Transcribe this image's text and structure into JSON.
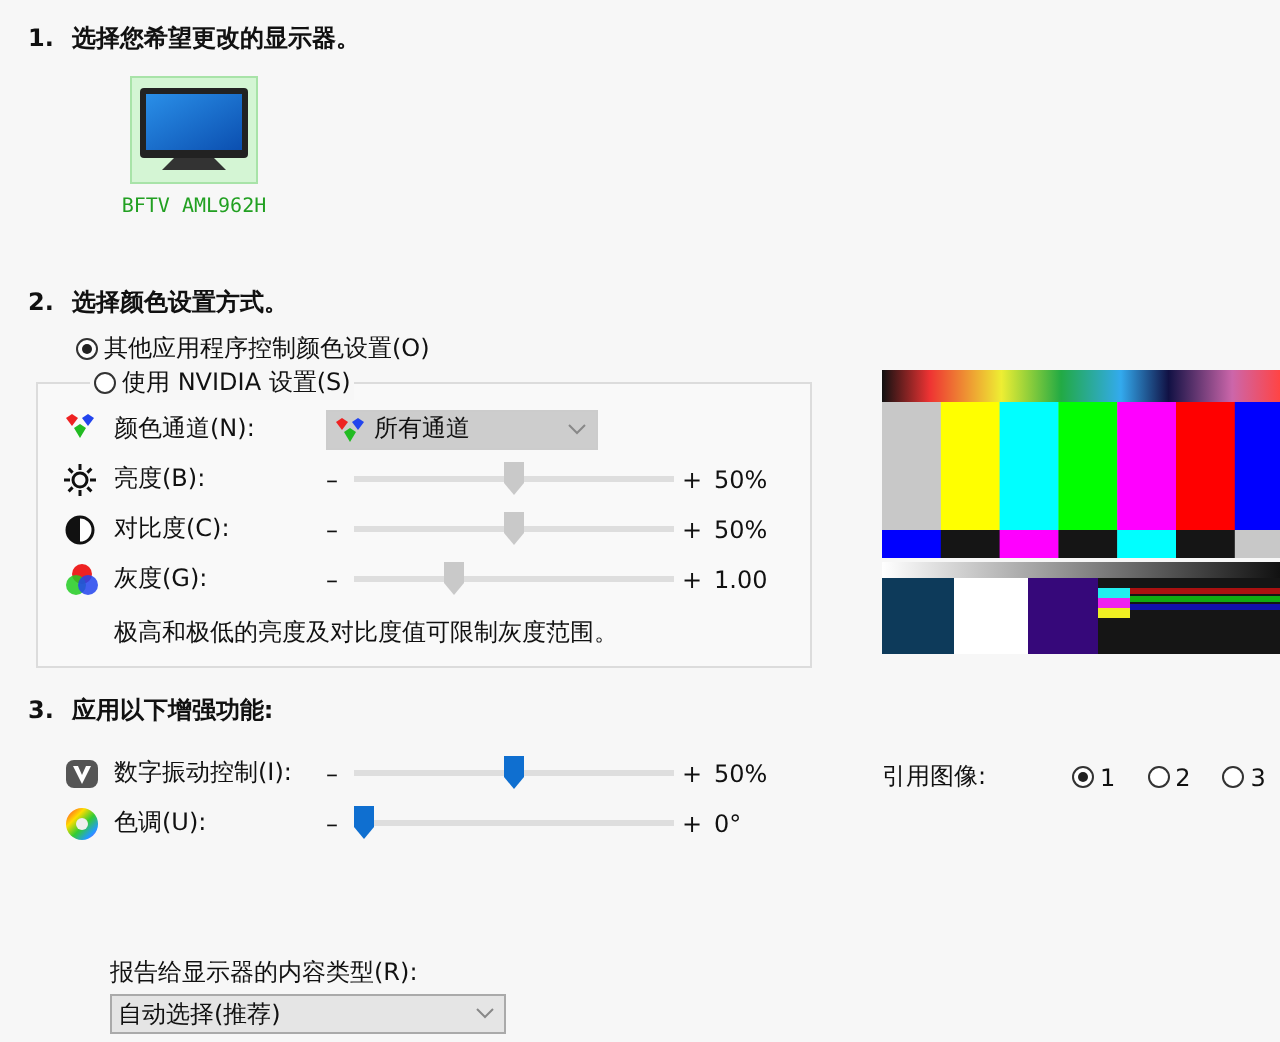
{
  "section1": {
    "number": "1.",
    "title": "选择您希望更改的显示器。",
    "displays": [
      {
        "label": "BFTV AML962H",
        "selected": true
      }
    ]
  },
  "section2": {
    "number": "2.",
    "title": "选择颜色设置方式。",
    "modes": [
      {
        "label": "其他应用程序控制颜色设置(O)",
        "selected": true
      },
      {
        "label": "使用 NVIDIA 设置(S)",
        "selected": false
      }
    ],
    "color_channel": {
      "label": "颜色通道(N):",
      "value": "所有通道"
    },
    "sliders": [
      {
        "kind": "brightness",
        "label": "亮度(B):",
        "minus": "–",
        "plus": "+",
        "reading": "50%",
        "level": 0.5
      },
      {
        "kind": "contrast",
        "label": "对比度(C):",
        "minus": "–",
        "plus": "+",
        "reading": "50%",
        "level": 0.5
      },
      {
        "kind": "gamma",
        "label": "灰度(G):",
        "minus": "–",
        "plus": "+",
        "reading": "1.00",
        "level": 0.3
      }
    ],
    "note": "极高和极低的亮度及对比度值可限制灰度范围。"
  },
  "section3": {
    "number": "3.",
    "title": "应用以下增强功能:",
    "sliders": [
      {
        "kind": "vibrance",
        "label": "数字振动控制(I):",
        "minus": "–",
        "plus": "+",
        "reading": "50%",
        "level": 0.5
      },
      {
        "kind": "hue",
        "label": "色调(U):",
        "minus": "–",
        "plus": "+",
        "reading": "0°",
        "level": 0
      }
    ],
    "content_type": {
      "label": "报告给显示器的内容类型(R):",
      "value": "自动选择(推荐)"
    }
  },
  "reference": {
    "label": "引用图像:",
    "options": [
      {
        "label": "1",
        "selected": true
      },
      {
        "label": "2",
        "selected": false
      },
      {
        "label": "3",
        "selected": false
      }
    ]
  }
}
